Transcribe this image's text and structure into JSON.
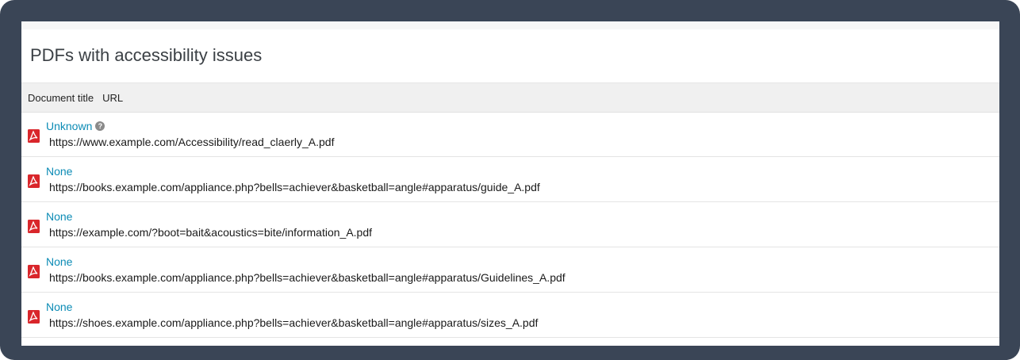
{
  "panel": {
    "title": "PDFs with accessibility issues"
  },
  "table": {
    "columns": [
      "Document title",
      "URL"
    ],
    "rows": [
      {
        "title": "Unknown",
        "has_help": true,
        "url": "https://www.example.com/Accessibility/read_claerly_A.pdf"
      },
      {
        "title": "None",
        "has_help": false,
        "url": "https://books.example.com/appliance.php?bells=achiever&basketball=angle#apparatus/guide_A.pdf"
      },
      {
        "title": "None",
        "has_help": false,
        "url": "https://example.com/?boot=bait&acoustics=bite/information_A.pdf"
      },
      {
        "title": "None",
        "has_help": false,
        "url": "https://books.example.com/appliance.php?bells=achiever&basketball=angle#apparatus/Guidelines_A.pdf"
      },
      {
        "title": "None",
        "has_help": false,
        "url": "https://shoes.example.com/appliance.php?bells=achiever&basketball=angle#apparatus/sizes_A.pdf"
      }
    ]
  },
  "icons": {
    "row_icon": "pdf-file-icon",
    "help": "question-circle-icon"
  },
  "colors": {
    "frame": "#3a4556",
    "link": "#0b8bb5",
    "pdf_red": "#d9262b"
  }
}
